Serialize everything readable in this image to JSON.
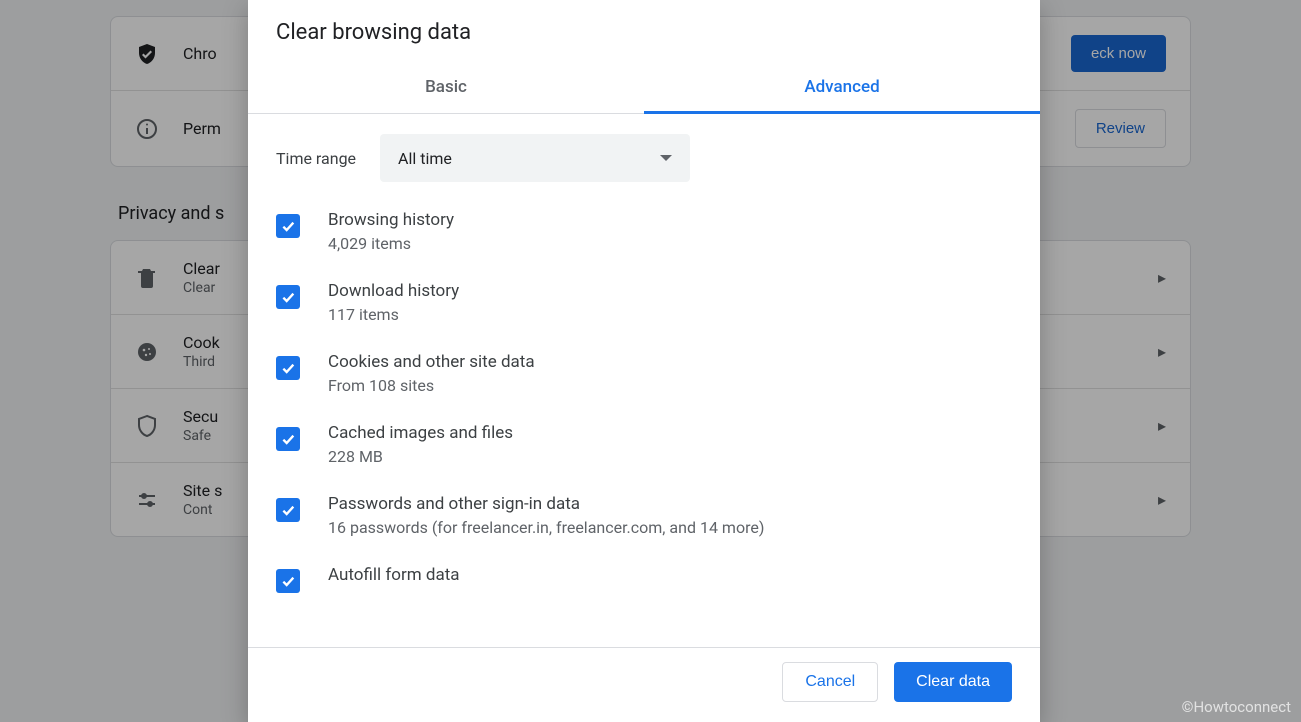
{
  "dialog": {
    "title": "Clear browsing data",
    "tabs": {
      "basic": "Basic",
      "advanced": "Advanced"
    },
    "active_tab": "advanced",
    "time_range": {
      "label": "Time range",
      "selected": "All time"
    },
    "items": {
      "browsing_history": {
        "title": "Browsing history",
        "sub": "4,029 items",
        "checked": true
      },
      "download_history": {
        "title": "Download history",
        "sub": "117 items",
        "checked": true
      },
      "cookies": {
        "title": "Cookies and other site data",
        "sub": "From 108 sites",
        "checked": true
      },
      "cached": {
        "title": "Cached images and files",
        "sub": "228 MB",
        "checked": true
      },
      "passwords": {
        "title": "Passwords and other sign-in data",
        "sub": "16 passwords (for freelancer.in, freelancer.com, and 14 more)",
        "checked": true
      },
      "autofill": {
        "title": "Autofill form data",
        "sub": "",
        "checked": true
      }
    },
    "buttons": {
      "cancel": "Cancel",
      "clear": "Clear data"
    }
  },
  "background": {
    "safety_row": {
      "title": "Chro",
      "button": "eck now"
    },
    "perm_row": {
      "title": "Perm",
      "button": "Review"
    },
    "section_heading": "Privacy and s",
    "rows": {
      "clear": {
        "title": "Clear",
        "sub": "Clear"
      },
      "cookies": {
        "title": "Cook",
        "sub": "Third"
      },
      "security": {
        "title": "Secu",
        "sub": "Safe"
      },
      "site": {
        "title": "Site s",
        "sub": "Cont"
      }
    }
  },
  "watermark": "©Howtoconnect"
}
